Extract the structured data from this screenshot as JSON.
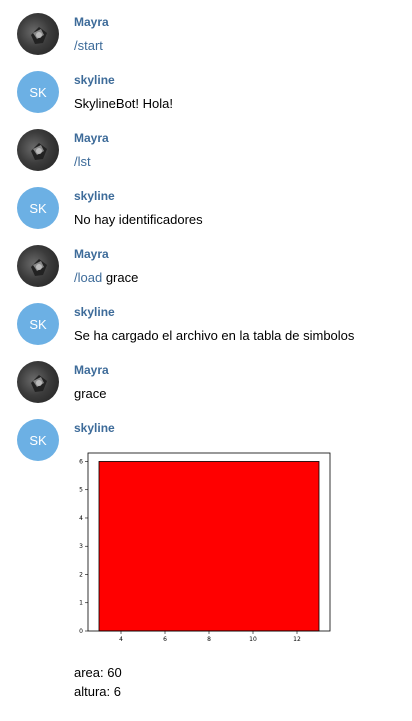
{
  "messages": [
    {
      "author": "Mayra",
      "command": "/start",
      "text": ""
    },
    {
      "author": "skyline",
      "avatar_initials": "SK",
      "text": "SkylineBot! Hola!"
    },
    {
      "author": "Mayra",
      "command": "/lst",
      "text": ""
    },
    {
      "author": "skyline",
      "avatar_initials": "SK",
      "text": "No hay identificadores"
    },
    {
      "author": "Mayra",
      "command": "/load",
      "text": " grace"
    },
    {
      "author": "skyline",
      "avatar_initials": "SK",
      "text": "Se ha cargado el archivo en la tabla de simbolos"
    },
    {
      "author": "Mayra",
      "text": "grace"
    },
    {
      "author": "skyline",
      "avatar_initials": "SK",
      "result_lines": [
        "area: 60",
        "altura: 6"
      ]
    }
  ],
  "colors": {
    "author": "#3d6b99",
    "bot_avatar": "#6cb0e4",
    "bar": "#ff0000"
  },
  "chart_data": {
    "type": "bar",
    "series": [
      {
        "x_start": 3,
        "x_end": 13,
        "height": 6
      }
    ],
    "xlim": [
      2.5,
      13.5
    ],
    "ylim": [
      0,
      6.3
    ],
    "xticks": [
      4,
      6,
      8,
      10,
      12
    ],
    "yticks": [
      0,
      1,
      2,
      3,
      4,
      5,
      6
    ],
    "bar_color": "#ff0000",
    "grid": false,
    "title": "",
    "xlabel": "",
    "ylabel": ""
  }
}
